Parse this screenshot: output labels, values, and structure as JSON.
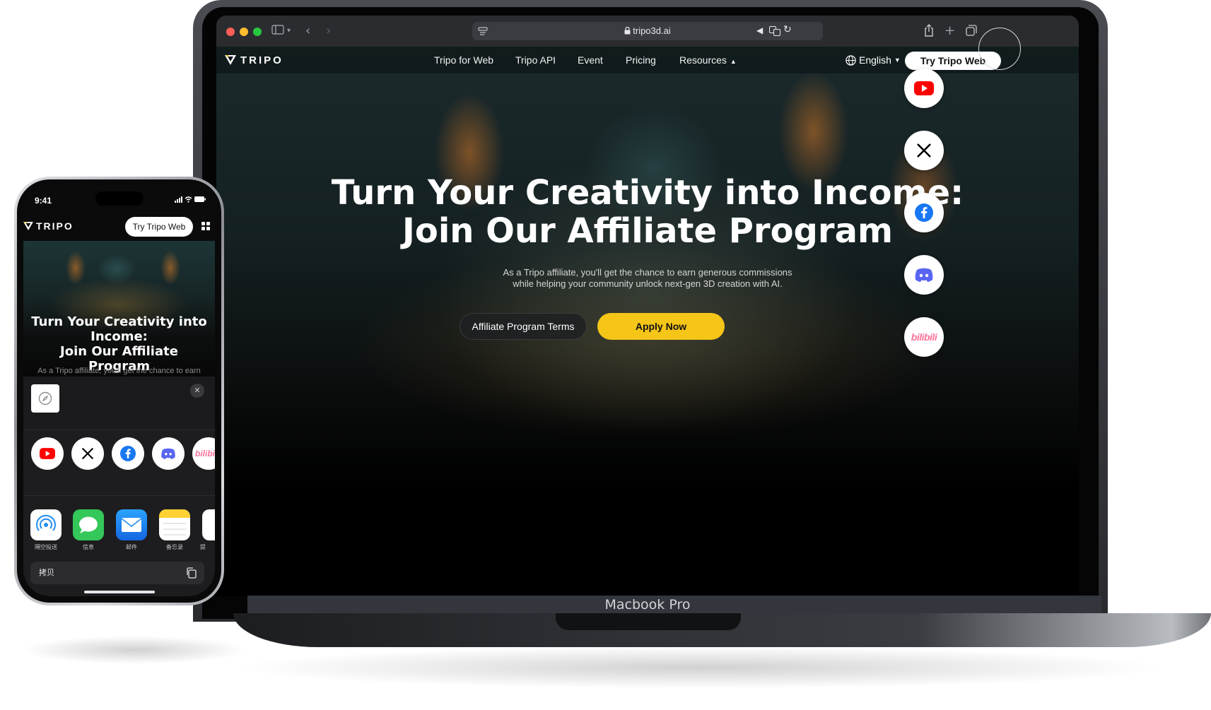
{
  "macbook": {
    "label": "Macbook Pro",
    "browser": {
      "url": "tripo3d.ai"
    },
    "site": {
      "logo": "TRIPO",
      "nav": [
        "Tripo for Web",
        "Tripo API",
        "Event",
        "Pricing",
        "Resources"
      ],
      "language": "English",
      "try_button": "Try Tripo Web",
      "hero_title_line1": "Turn Your Creativity into Income:",
      "hero_title_line2": "Join Our Affiliate Program",
      "hero_sub_line1": "As a Tripo affiliate, you'll get the chance to earn generous commissions",
      "hero_sub_line2": "while helping your community unlock next-gen 3D creation with AI.",
      "terms_button": "Affiliate Program Terms",
      "apply_button": "Apply Now"
    },
    "share_icons": [
      "youtube-icon",
      "x-icon",
      "facebook-icon",
      "discord-icon",
      "bilibili-icon"
    ],
    "bilibili_text": "bilibili"
  },
  "iphone": {
    "status_time": "9:41",
    "logo": "TRIPO",
    "try_button": "Try Tripo Web",
    "hero_title_line1": "Turn Your Creativity into",
    "hero_title_line2": "Income:",
    "hero_title_line3": "Join Our Affiliate Program",
    "hero_sub": "As a Tripo affiliate, you'll get the chance to earn",
    "close_glyph": "✕",
    "apps": [
      {
        "label": "隔空投送",
        "color": "#ffffff"
      },
      {
        "label": "信息",
        "color": "#34c759"
      },
      {
        "label": "邮件",
        "color": "#1f8ef1"
      },
      {
        "label": "备忘录",
        "color": "#ffffff"
      },
      {
        "label": "提",
        "color": "#ffffff"
      }
    ],
    "copy_label": "拷贝"
  },
  "colors": {
    "accent_yellow": "#f5c518",
    "youtube_red": "#ff0000",
    "facebook_blue": "#1877f2",
    "discord_blurple": "#5865f2",
    "bilibili_pink": "#fb7299"
  }
}
